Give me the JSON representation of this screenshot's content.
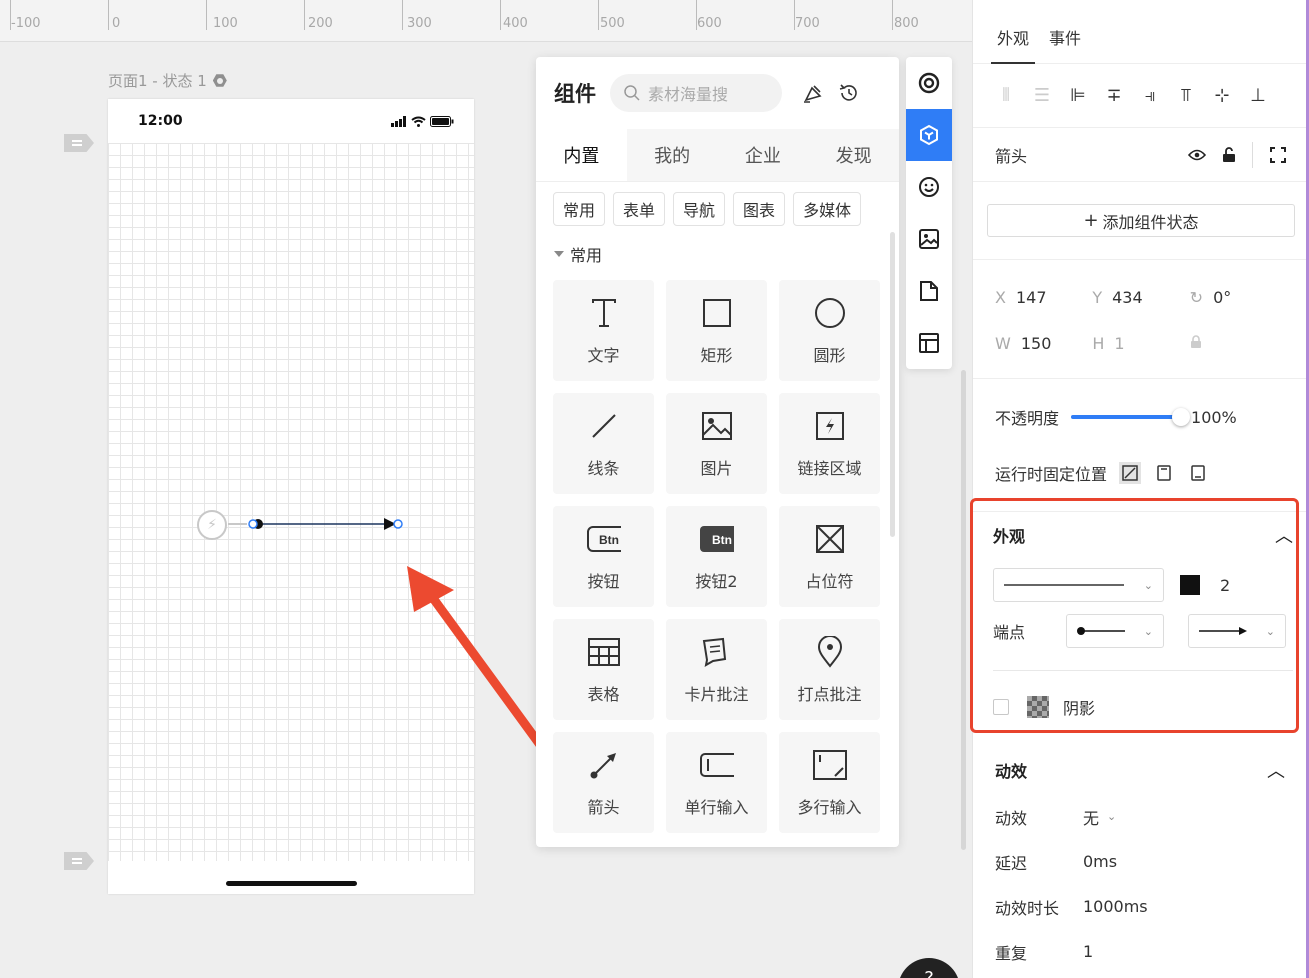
{
  "ruler": {
    "labels": [
      "-100",
      "0",
      "100",
      "200",
      "300",
      "400",
      "500",
      "600",
      "700",
      "800"
    ]
  },
  "canvas": {
    "page_title": "页面1 - 状态 1",
    "phone_time": "12:00"
  },
  "components_panel": {
    "title": "组件",
    "search_placeholder": "素材海量搜",
    "tabs": [
      "内置",
      "我的",
      "企业",
      "发现"
    ],
    "active_tab": "内置",
    "chips": [
      "常用",
      "表单",
      "导航",
      "图表",
      "多媒体"
    ],
    "section": "常用",
    "items": [
      {
        "label": "文字",
        "icon": "text-icon"
      },
      {
        "label": "矩形",
        "icon": "rectangle-icon"
      },
      {
        "label": "圆形",
        "icon": "circle-icon"
      },
      {
        "label": "线条",
        "icon": "line-icon"
      },
      {
        "label": "图片",
        "icon": "image-icon"
      },
      {
        "label": "链接区域",
        "icon": "link-area-icon"
      },
      {
        "label": "按钮",
        "icon": "button-icon",
        "icon_text": "Btn"
      },
      {
        "label": "按钮2",
        "icon": "button2-icon",
        "icon_text": "Btn"
      },
      {
        "label": "占位符",
        "icon": "placeholder-icon"
      },
      {
        "label": "表格",
        "icon": "table-icon"
      },
      {
        "label": "卡片批注",
        "icon": "card-note-icon"
      },
      {
        "label": "打点批注",
        "icon": "pin-note-icon"
      },
      {
        "label": "箭头",
        "icon": "arrow-icon"
      },
      {
        "label": "单行输入",
        "icon": "single-input-icon"
      },
      {
        "label": "多行输入",
        "icon": "multi-input-icon"
      }
    ]
  },
  "icon_bar": [
    "target-icon",
    "component-icon",
    "emoji-icon",
    "image-icon",
    "document-icon",
    "layout-icon"
  ],
  "properties": {
    "tabs": [
      "外观",
      "事件"
    ],
    "active_tab": "外观",
    "element_name": "箭头",
    "add_state_label": "添加组件状态",
    "geometry": {
      "x_label": "X",
      "x": "147",
      "y_label": "Y",
      "y": "434",
      "rotation": "0°",
      "w_label": "W",
      "w": "150",
      "h_label": "H",
      "h": "1"
    },
    "opacity_label": "不透明度",
    "opacity_value": "100%",
    "opacity_fraction": 1.0,
    "fixed_position_label": "运行时固定位置",
    "appearance": {
      "title": "外观",
      "stroke_width": "2",
      "stroke_color": "#111111",
      "endpoint_label": "端点",
      "shadow_label": "阴影"
    },
    "animation": {
      "title": "动效",
      "rows": [
        {
          "label": "动效",
          "value": "无"
        },
        {
          "label": "延迟",
          "value": "0ms"
        },
        {
          "label": "动效时长",
          "value": "1000ms"
        },
        {
          "label": "重复",
          "value": "1"
        }
      ]
    }
  },
  "colors": {
    "accent": "#2f7df6",
    "highlight": "#e8432d"
  }
}
